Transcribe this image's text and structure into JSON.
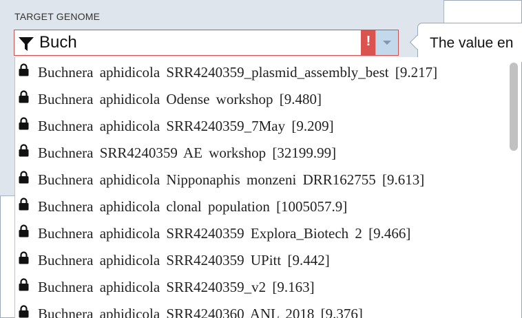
{
  "field": {
    "label": "TARGET GENOME",
    "value": "Buch",
    "error_badge": "!"
  },
  "tooltip": {
    "text": "The value en"
  },
  "options": [
    "Buchnera aphidicola SRR4240359_plasmid_assembly_best [9.217]",
    "Buchnera aphidicola Odense workshop [9.480]",
    "Buchnera aphidicola SRR4240359_7May [9.209]",
    "Buchnera SRR4240359 AE workshop [32199.99]",
    "Buchnera aphidicola Nipponaphis monzeni DRR162755 [9.613]",
    "Buchnera aphidicola clonal population [1005057.9]",
    "Buchnera aphidicola SRR4240359 Explora_Biotech 2 [9.466]",
    "Buchnera aphidicola SRR4240359 UPitt [9.442]",
    "Buchnera aphidicola SRR4240359_v2 [9.163]",
    "Buchnera aphidicola SRR4240360 ANL 2018 [9.376]"
  ],
  "icons": {
    "filter": "filter-icon",
    "lock": "lock-icon",
    "dropdown": "chevron-down-icon"
  },
  "colors": {
    "error": "#d9534f",
    "panel": "#dfe5ec",
    "arrow_button": "#c4d8ec"
  }
}
